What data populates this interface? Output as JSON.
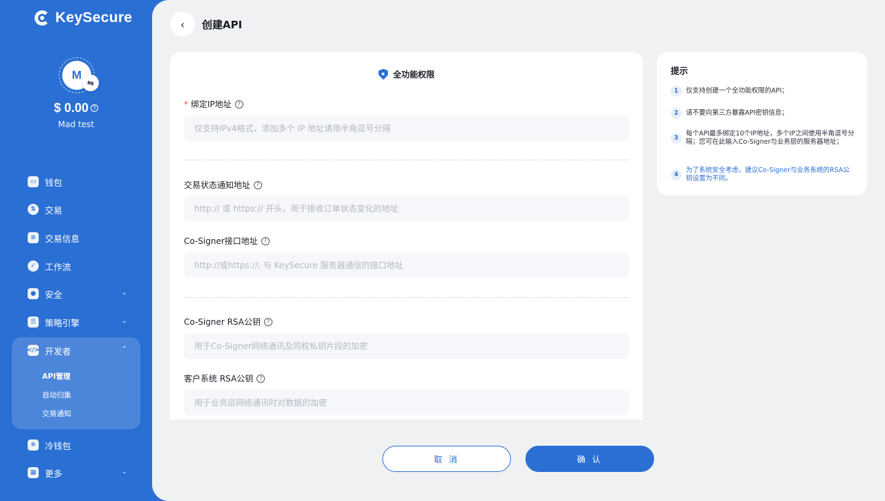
{
  "brand": {
    "name": "KeySecure"
  },
  "account": {
    "avatar_letter": "M",
    "balance": "$ 0.00",
    "name": "Mad test"
  },
  "nav": {
    "wallet": "钱包",
    "trade": "交易",
    "trade_info": "交易信息",
    "workflow": "工作流",
    "security": "安全",
    "policy": "策略引擎",
    "developer": "开发者",
    "dev_sub": [
      "API管理",
      "自动归集",
      "交易通知"
    ],
    "cold_wallet": "冷钱包",
    "more": "更多"
  },
  "header": {
    "title": "创建API"
  },
  "form": {
    "permission": "全功能权限",
    "ip": {
      "label": "绑定IP地址",
      "placeholder": "仅支持IPv4格式，添加多个 IP 地址请用半角逗号分隔"
    },
    "notify": {
      "label": "交易状态通知地址",
      "placeholder": "http:// 或 https:// 开头，用于接收订单状态变化的地址"
    },
    "cosigner": {
      "label": "Co-Signer接口地址",
      "placeholder": "http://或https://; 与 KeySecure 服务器通信的接口地址"
    },
    "cosigner_rsa": {
      "label": "Co-Signer RSA公钥",
      "placeholder": "用于Co-Signer网络通讯及同权私钥片段的加密"
    },
    "client_rsa": {
      "label": "客户系统 RSA公钥",
      "placeholder": "用于业务层网络通讯时对数据的加密"
    }
  },
  "actions": {
    "cancel": "取 消",
    "confirm": "确 认"
  },
  "tips": {
    "title": "提示",
    "items": [
      {
        "num": "1",
        "text": "仅支持创建一个全功能权限的API；"
      },
      {
        "num": "2",
        "text": "请不要向第三方暴露API密钥信息；"
      },
      {
        "num": "3",
        "text": "每个API最多绑定10个IP地址，多个IP之间使用半角逗号分隔；您可在此输入Co-Signer与业务层的服务器地址；"
      },
      {
        "num": "4",
        "text": "为了系统安全考虑，建议Co-Signer与业务系统的RSA公钥设置为不同。"
      }
    ]
  }
}
